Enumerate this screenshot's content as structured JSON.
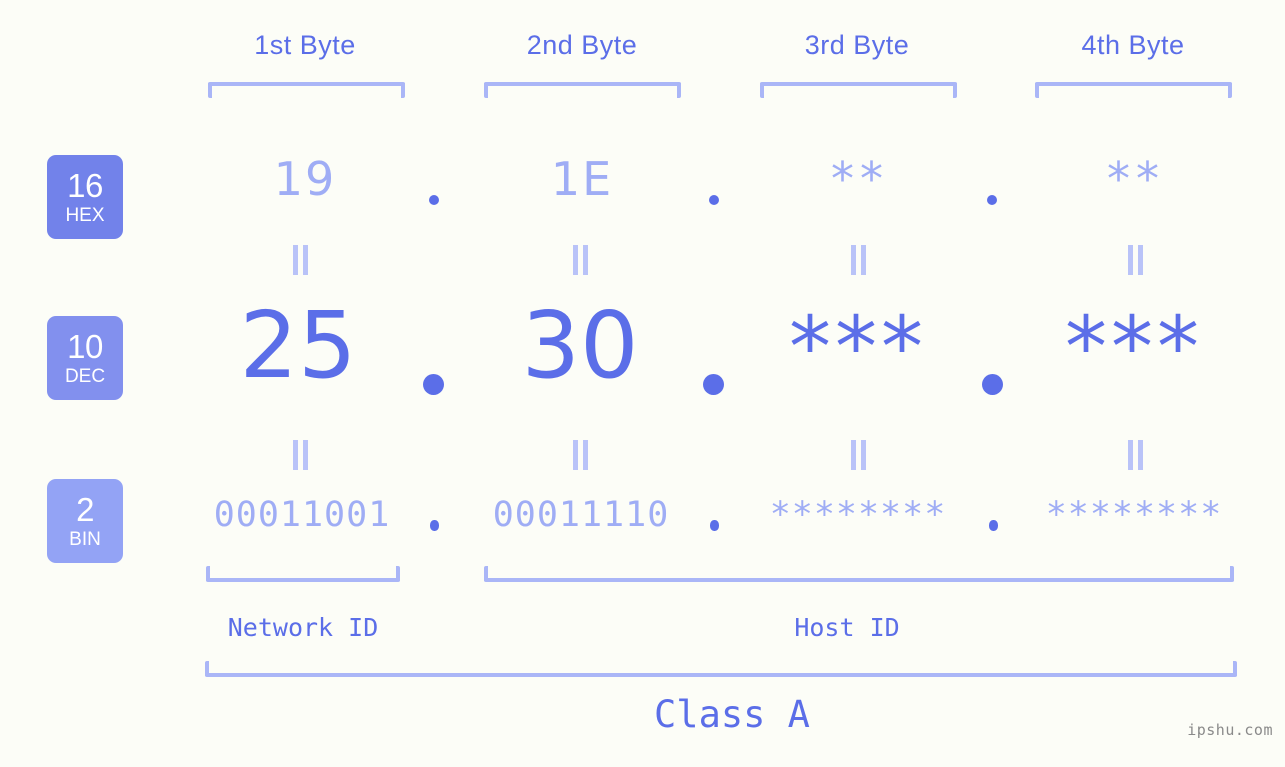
{
  "background_color": "#fcfdf7",
  "accent_color": "#5b6ee8",
  "accent_light_color": "#9fadf5",
  "bracket_color": "#aab6f7",
  "byte_headers": [
    {
      "label": "1st Byte"
    },
    {
      "label": "2nd Byte"
    },
    {
      "label": "3rd Byte"
    },
    {
      "label": "4th Byte"
    }
  ],
  "bases": [
    {
      "number": "16",
      "name": "HEX",
      "color": "#7282ea"
    },
    {
      "number": "10",
      "name": "DEC",
      "color": "#8290ee"
    },
    {
      "number": "2",
      "name": "BIN",
      "color": "#93a3f5"
    }
  ],
  "rows": {
    "hex": {
      "values": [
        "19",
        "1E",
        "**",
        "**"
      ]
    },
    "dec": {
      "values": [
        "25",
        "30",
        "***",
        "***"
      ]
    },
    "bin": {
      "values": [
        "00011001",
        "00011110",
        "********",
        "********"
      ]
    }
  },
  "separators": {
    "dot": ".",
    "equals": "="
  },
  "footer": {
    "network_id_label": "Network ID",
    "host_id_label": "Host ID",
    "class_label": "Class A",
    "watermark": "ipshu.com"
  }
}
